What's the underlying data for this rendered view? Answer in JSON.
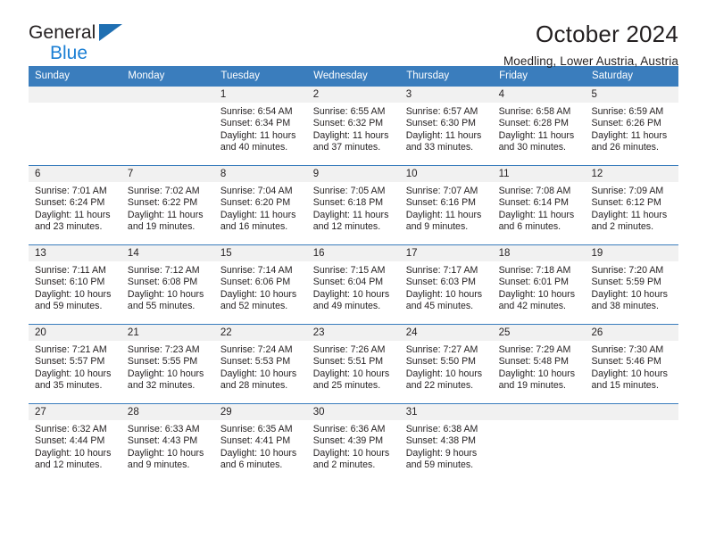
{
  "brand": {
    "name_top": "General",
    "name_bottom": "Blue",
    "accent_color": "#1b7fd4",
    "triangle_color": "#1f6fb2"
  },
  "header": {
    "title": "October 2024",
    "location": "Moedling, Lower Austria, Austria"
  },
  "calendar": {
    "header_bg": "#3a7dbd",
    "daynum_bg": "#f1f1f1",
    "weekday_headers": [
      "Sunday",
      "Monday",
      "Tuesday",
      "Wednesday",
      "Thursday",
      "Friday",
      "Saturday"
    ],
    "weeks": [
      [
        {
          "day": "",
          "empty": true,
          "sunrise": "",
          "sunset": "",
          "daylight": ""
        },
        {
          "day": "",
          "empty": true,
          "sunrise": "",
          "sunset": "",
          "daylight": ""
        },
        {
          "day": "1",
          "sunrise": "Sunrise: 6:54 AM",
          "sunset": "Sunset: 6:34 PM",
          "daylight": "Daylight: 11 hours and 40 minutes."
        },
        {
          "day": "2",
          "sunrise": "Sunrise: 6:55 AM",
          "sunset": "Sunset: 6:32 PM",
          "daylight": "Daylight: 11 hours and 37 minutes."
        },
        {
          "day": "3",
          "sunrise": "Sunrise: 6:57 AM",
          "sunset": "Sunset: 6:30 PM",
          "daylight": "Daylight: 11 hours and 33 minutes."
        },
        {
          "day": "4",
          "sunrise": "Sunrise: 6:58 AM",
          "sunset": "Sunset: 6:28 PM",
          "daylight": "Daylight: 11 hours and 30 minutes."
        },
        {
          "day": "5",
          "sunrise": "Sunrise: 6:59 AM",
          "sunset": "Sunset: 6:26 PM",
          "daylight": "Daylight: 11 hours and 26 minutes."
        }
      ],
      [
        {
          "day": "6",
          "sunrise": "Sunrise: 7:01 AM",
          "sunset": "Sunset: 6:24 PM",
          "daylight": "Daylight: 11 hours and 23 minutes."
        },
        {
          "day": "7",
          "sunrise": "Sunrise: 7:02 AM",
          "sunset": "Sunset: 6:22 PM",
          "daylight": "Daylight: 11 hours and 19 minutes."
        },
        {
          "day": "8",
          "sunrise": "Sunrise: 7:04 AM",
          "sunset": "Sunset: 6:20 PM",
          "daylight": "Daylight: 11 hours and 16 minutes."
        },
        {
          "day": "9",
          "sunrise": "Sunrise: 7:05 AM",
          "sunset": "Sunset: 6:18 PM",
          "daylight": "Daylight: 11 hours and 12 minutes."
        },
        {
          "day": "10",
          "sunrise": "Sunrise: 7:07 AM",
          "sunset": "Sunset: 6:16 PM",
          "daylight": "Daylight: 11 hours and 9 minutes."
        },
        {
          "day": "11",
          "sunrise": "Sunrise: 7:08 AM",
          "sunset": "Sunset: 6:14 PM",
          "daylight": "Daylight: 11 hours and 6 minutes."
        },
        {
          "day": "12",
          "sunrise": "Sunrise: 7:09 AM",
          "sunset": "Sunset: 6:12 PM",
          "daylight": "Daylight: 11 hours and 2 minutes."
        }
      ],
      [
        {
          "day": "13",
          "sunrise": "Sunrise: 7:11 AM",
          "sunset": "Sunset: 6:10 PM",
          "daylight": "Daylight: 10 hours and 59 minutes."
        },
        {
          "day": "14",
          "sunrise": "Sunrise: 7:12 AM",
          "sunset": "Sunset: 6:08 PM",
          "daylight": "Daylight: 10 hours and 55 minutes."
        },
        {
          "day": "15",
          "sunrise": "Sunrise: 7:14 AM",
          "sunset": "Sunset: 6:06 PM",
          "daylight": "Daylight: 10 hours and 52 minutes."
        },
        {
          "day": "16",
          "sunrise": "Sunrise: 7:15 AM",
          "sunset": "Sunset: 6:04 PM",
          "daylight": "Daylight: 10 hours and 49 minutes."
        },
        {
          "day": "17",
          "sunrise": "Sunrise: 7:17 AM",
          "sunset": "Sunset: 6:03 PM",
          "daylight": "Daylight: 10 hours and 45 minutes."
        },
        {
          "day": "18",
          "sunrise": "Sunrise: 7:18 AM",
          "sunset": "Sunset: 6:01 PM",
          "daylight": "Daylight: 10 hours and 42 minutes."
        },
        {
          "day": "19",
          "sunrise": "Sunrise: 7:20 AM",
          "sunset": "Sunset: 5:59 PM",
          "daylight": "Daylight: 10 hours and 38 minutes."
        }
      ],
      [
        {
          "day": "20",
          "sunrise": "Sunrise: 7:21 AM",
          "sunset": "Sunset: 5:57 PM",
          "daylight": "Daylight: 10 hours and 35 minutes."
        },
        {
          "day": "21",
          "sunrise": "Sunrise: 7:23 AM",
          "sunset": "Sunset: 5:55 PM",
          "daylight": "Daylight: 10 hours and 32 minutes."
        },
        {
          "day": "22",
          "sunrise": "Sunrise: 7:24 AM",
          "sunset": "Sunset: 5:53 PM",
          "daylight": "Daylight: 10 hours and 28 minutes."
        },
        {
          "day": "23",
          "sunrise": "Sunrise: 7:26 AM",
          "sunset": "Sunset: 5:51 PM",
          "daylight": "Daylight: 10 hours and 25 minutes."
        },
        {
          "day": "24",
          "sunrise": "Sunrise: 7:27 AM",
          "sunset": "Sunset: 5:50 PM",
          "daylight": "Daylight: 10 hours and 22 minutes."
        },
        {
          "day": "25",
          "sunrise": "Sunrise: 7:29 AM",
          "sunset": "Sunset: 5:48 PM",
          "daylight": "Daylight: 10 hours and 19 minutes."
        },
        {
          "day": "26",
          "sunrise": "Sunrise: 7:30 AM",
          "sunset": "Sunset: 5:46 PM",
          "daylight": "Daylight: 10 hours and 15 minutes."
        }
      ],
      [
        {
          "day": "27",
          "sunrise": "Sunrise: 6:32 AM",
          "sunset": "Sunset: 4:44 PM",
          "daylight": "Daylight: 10 hours and 12 minutes."
        },
        {
          "day": "28",
          "sunrise": "Sunrise: 6:33 AM",
          "sunset": "Sunset: 4:43 PM",
          "daylight": "Daylight: 10 hours and 9 minutes."
        },
        {
          "day": "29",
          "sunrise": "Sunrise: 6:35 AM",
          "sunset": "Sunset: 4:41 PM",
          "daylight": "Daylight: 10 hours and 6 minutes."
        },
        {
          "day": "30",
          "sunrise": "Sunrise: 6:36 AM",
          "sunset": "Sunset: 4:39 PM",
          "daylight": "Daylight: 10 hours and 2 minutes."
        },
        {
          "day": "31",
          "sunrise": "Sunrise: 6:38 AM",
          "sunset": "Sunset: 4:38 PM",
          "daylight": "Daylight: 9 hours and 59 minutes."
        },
        {
          "day": "",
          "empty": true,
          "sunrise": "",
          "sunset": "",
          "daylight": ""
        },
        {
          "day": "",
          "empty": true,
          "sunrise": "",
          "sunset": "",
          "daylight": ""
        }
      ]
    ]
  }
}
